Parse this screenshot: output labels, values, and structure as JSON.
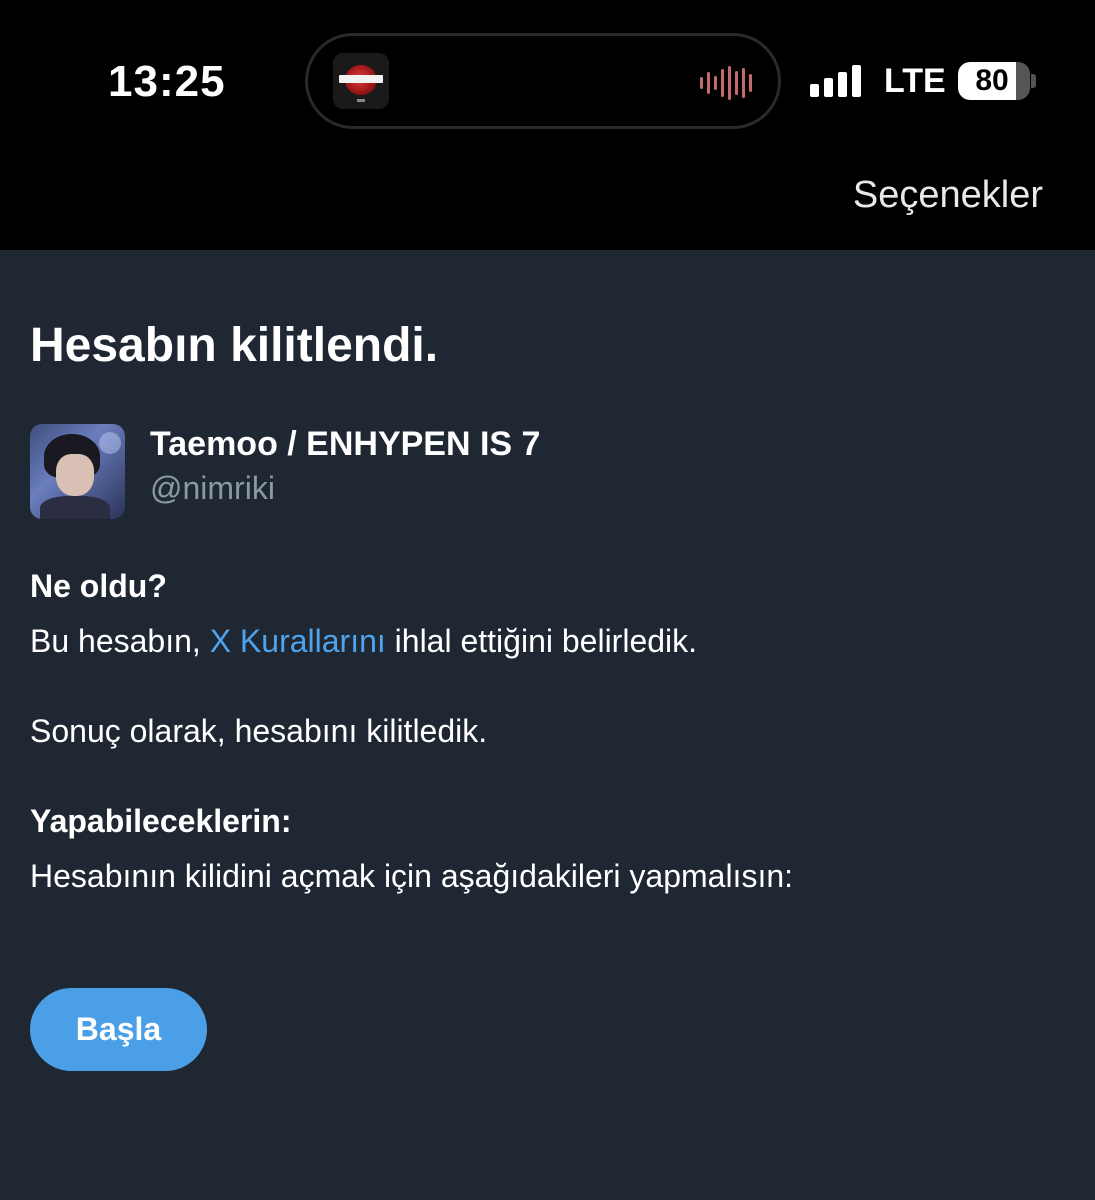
{
  "status_bar": {
    "time": "13:25",
    "network": "LTE",
    "battery_percent": 80,
    "battery_label": "80",
    "signal_bars": 4,
    "now_playing": {
      "album_art_icon": "album-art-icon",
      "waveform_icon": "audio-waveform-icon",
      "waveform_color": "#c46a6a"
    }
  },
  "header": {
    "options_label": "Seçenekler"
  },
  "page": {
    "title": "Hesabın kilitlendi."
  },
  "account": {
    "display_name": "Taemoo / ENHYPEN IS 7",
    "handle": "@nimriki"
  },
  "what_happened": {
    "heading": "Ne oldu?",
    "text_before_link": "Bu hesabın, ",
    "link_text": "X Kurallarını",
    "text_after_link": " ihlal ettiğini belirledik.",
    "result_text": "Sonuç olarak, hesabını kilitledik."
  },
  "what_you_can_do": {
    "heading": "Yapabileceklerin:",
    "text": "Hesabının kilidini açmak için aşağıdakileri yapmalısın:"
  },
  "actions": {
    "start_label": "Başla"
  },
  "colors": {
    "top_background": "#000000",
    "page_background": "#1e2732",
    "accent_link": "#4fa3ec",
    "button_background": "#4a9fe6",
    "secondary_text": "#8b98a5"
  }
}
